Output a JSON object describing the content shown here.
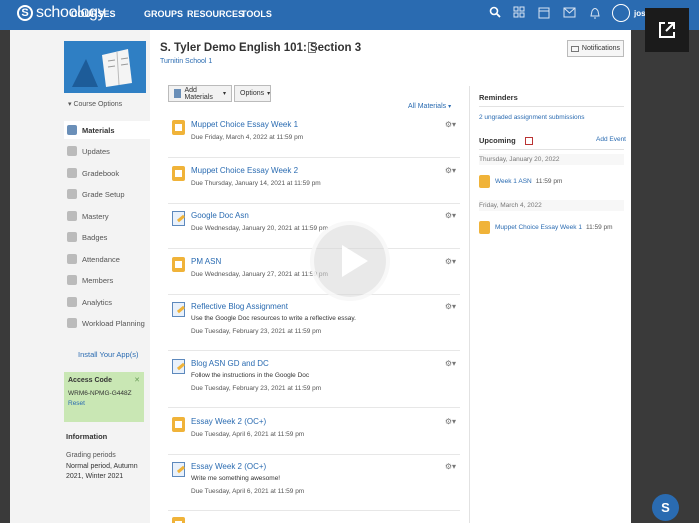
{
  "topbar": {
    "logo": "schoology",
    "nav": [
      "COURSES",
      "GROUPS",
      "RESOURCES",
      "TOOLS"
    ],
    "icons": [
      "search-icon",
      "apps-grid-icon",
      "calendar-icon",
      "mail-icon",
      "bell-icon"
    ],
    "user_name": "josh Chu"
  },
  "course": {
    "title": "S. Tyler Demo English 101: Section 3",
    "school": "Turnitin School 1",
    "notifications_label": "Notifications"
  },
  "sidebar": {
    "course_options": "Course Options",
    "items": [
      {
        "label": "Materials"
      },
      {
        "label": "Updates"
      },
      {
        "label": "Gradebook"
      },
      {
        "label": "Grade Setup"
      },
      {
        "label": "Mastery"
      },
      {
        "label": "Badges"
      },
      {
        "label": "Attendance"
      },
      {
        "label": "Members"
      },
      {
        "label": "Analytics"
      },
      {
        "label": "Workload Planning"
      }
    ],
    "install_app": "Install Your App(s)",
    "access_code": {
      "title": "Access Code",
      "code": "WRM6-NPMG-G448Z",
      "reset": "Reset"
    },
    "information": {
      "title": "Information",
      "label": "Grading periods",
      "value": "Normal period, Autumn 2021, Winter 2021"
    }
  },
  "toolbar": {
    "add_materials": "Add Materials",
    "options": "Options",
    "all_materials": "All Materials"
  },
  "materials": [
    {
      "icon": "assignment-icon",
      "title": "Muppet Choice Essay Week 1",
      "desc": "",
      "due": "Due Friday, March 4, 2022 at 11:59 pm"
    },
    {
      "icon": "assignment-icon",
      "title": "Muppet Choice Essay Week 2",
      "desc": "",
      "due": "Due Thursday, January 14, 2021 at 11:59 pm"
    },
    {
      "icon": "google-doc-icon",
      "title": "Google Doc Asn",
      "desc": "",
      "due": "Due Wednesday, January 20, 2021 at 11:59 pm"
    },
    {
      "icon": "assignment-icon",
      "title": "PM ASN",
      "desc": "",
      "due": "Due Wednesday, January 27, 2021 at 11:59 pm"
    },
    {
      "icon": "google-doc-icon",
      "title": "Reflective Blog Assignment",
      "desc": "Use the Google Doc resources to write a reflective essay.",
      "due": "Due Tuesday, February 23, 2021 at 11:59 pm"
    },
    {
      "icon": "google-doc-icon",
      "title": "Blog ASN GD and DC",
      "desc": "Follow the instructions in the Google Doc",
      "due": "Due Tuesday, February 23, 2021 at 11:59 pm"
    },
    {
      "icon": "assignment-icon",
      "title": "Essay Week 2 (OC+)",
      "desc": "",
      "due": "Due Tuesday, April 6, 2021 at 11:59 pm"
    },
    {
      "icon": "google-doc-icon",
      "title": "Essay Week 2 (OC+)",
      "desc": "Write me something awesome!",
      "due": "Due Tuesday, April 6, 2021 at 11:59 pm"
    }
  ],
  "reminders": {
    "title": "Reminders",
    "ungraded": "2 ungraded assignment submissions"
  },
  "upcoming": {
    "title": "Upcoming",
    "add_event": "Add Event",
    "days": [
      {
        "date": "Thursday, January 20, 2022",
        "event": "Week 1 ASN",
        "time": "11:59 pm"
      },
      {
        "date": "Friday, March 4, 2022",
        "event": "Muppet Choice Essay Week 1",
        "time": "11:59 pm"
      }
    ]
  },
  "help_bubble": "S",
  "colors": {
    "brand": "#2a6bb1",
    "assignment": "#f0b339",
    "access_box": "#c9e7b4"
  }
}
